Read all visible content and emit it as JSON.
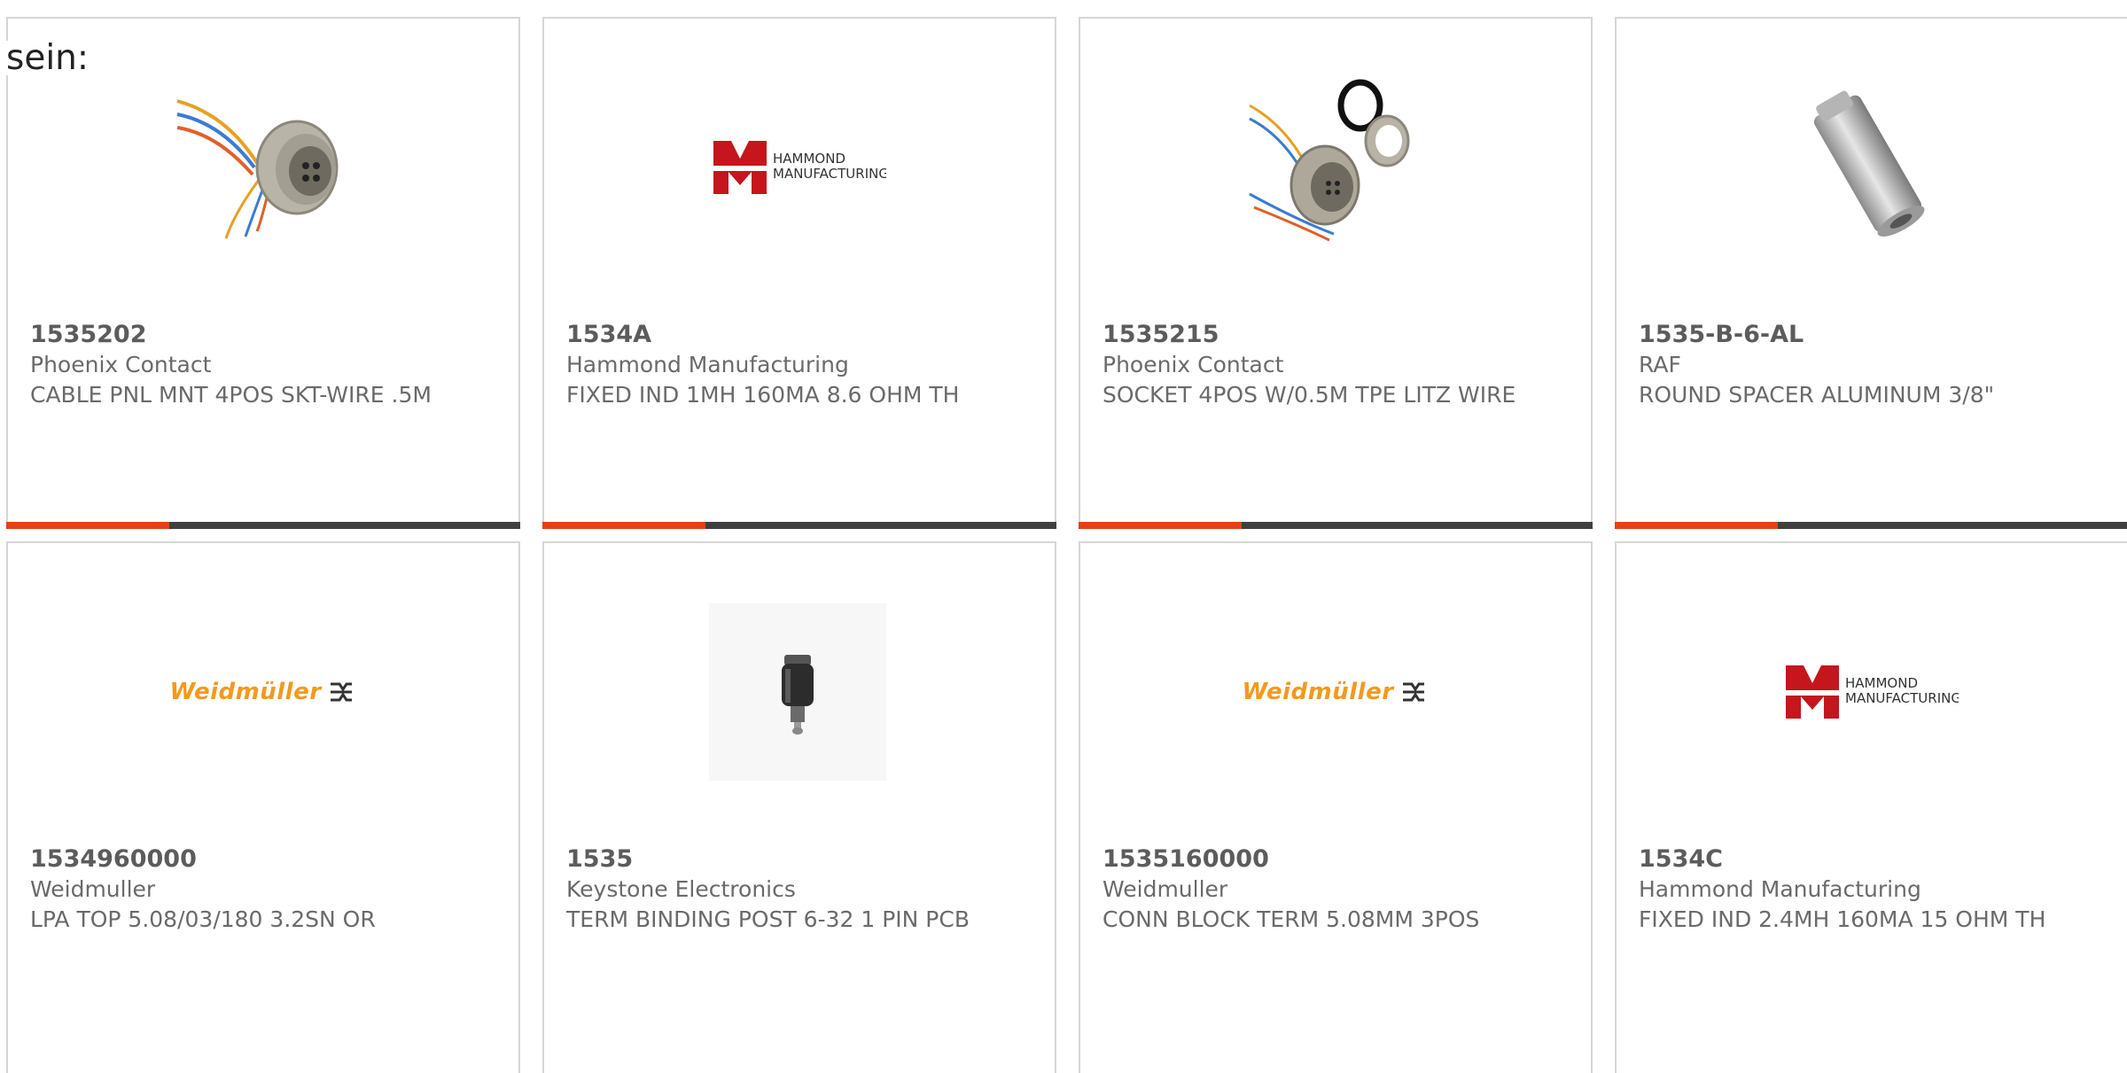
{
  "intro_text": "sein:",
  "products": [
    {
      "part": "1535202",
      "manufacturer": "Phoenix Contact",
      "description": "CABLE PNL MNT 4POS SKT-WIRE .5M",
      "image": "cable-connector-photo"
    },
    {
      "part": "1534A",
      "manufacturer": "Hammond Manufacturing",
      "description": "FIXED IND 1MH 160MA 8.6 OHM TH",
      "image": "hammond-logo"
    },
    {
      "part": "1535215",
      "manufacturer": "Phoenix Contact",
      "description": "SOCKET 4POS W/0.5M TPE LITZ WIRE",
      "image": "socket-connector-photo"
    },
    {
      "part": "1535-B-6-AL",
      "manufacturer": "RAF",
      "description": "ROUND SPACER ALUMINUM 3/8\"",
      "image": "aluminum-spacer-photo"
    },
    {
      "part": "1534960000",
      "manufacturer": "Weidmuller",
      "description": "LPA TOP 5.08/03/180 3.2SN OR",
      "image": "weidmuller-logo"
    },
    {
      "part": "1535",
      "manufacturer": "Keystone Electronics",
      "description": "TERM BINDING POST 6-32 1 PIN PCB",
      "image": "binding-post-photo"
    },
    {
      "part": "1535160000",
      "manufacturer": "Weidmuller",
      "description": "CONN BLOCK TERM 5.08MM 3POS",
      "image": "weidmuller-logo"
    },
    {
      "part": "1534C",
      "manufacturer": "Hammond Manufacturing",
      "description": "FIXED IND 2.4MH 160MA 15 OHM TH",
      "image": "hammond-logo"
    }
  ],
  "logos": {
    "hammond_line1": "HAMMOND",
    "hammond_line2": "MANUFACTURING.",
    "weidmuller": "Weidmüller"
  },
  "colors": {
    "accent": "#e4411b",
    "bar": "#404040",
    "hammond_red": "#c4161c",
    "weidmuller_orange": "#f29a1d"
  }
}
